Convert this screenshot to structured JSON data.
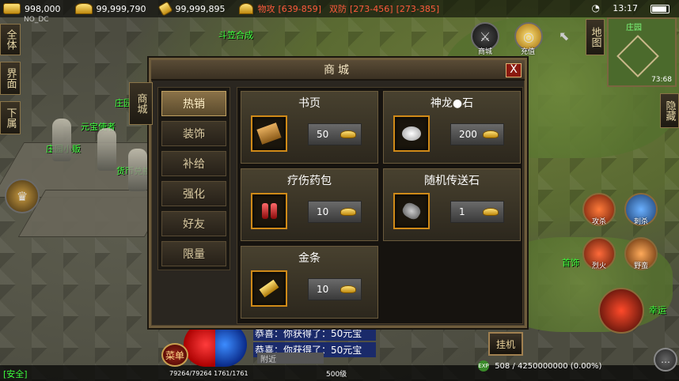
{
  "topbar": {
    "gold": "998,000",
    "ingot": "99,999,790",
    "bound_ingot": "99,999,895",
    "attack_label": "物攻",
    "attack_value": "[639-859]",
    "defense_label": "双防",
    "defense_value": "[273-456]",
    "defense_value2": "[273-385]",
    "clock": "13:17",
    "top_overlay": "NO_DC"
  },
  "left_side": [
    "全体",
    "界面",
    "下属"
  ],
  "right_side": {
    "map": "地图",
    "hide": "隐藏"
  },
  "minimap": {
    "name": "庄园",
    "coords": "73:68"
  },
  "top_icons": {
    "shop": "商城",
    "recharge": "充值"
  },
  "npcs": {
    "hat_merge": "斗笠合成",
    "yuanbao_envoy": "元宝使者",
    "manor_vendor": "庄园小贩",
    "currency_exchange": "货币兑换",
    "manor_master": "庄园"
  },
  "skills": {
    "s1": "攻杀",
    "s2": "刺杀",
    "s3": "烈火",
    "s4": "野蛮",
    "jewelry": "首饰",
    "luck": "幸运"
  },
  "shop": {
    "title": "商城",
    "close": "X",
    "side_tab": "商城",
    "categories": [
      "热销",
      "装饰",
      "补给",
      "强化",
      "好友",
      "限量"
    ],
    "items": [
      {
        "name": "书页",
        "price": "50"
      },
      {
        "name": "神龙●石",
        "price": "200"
      },
      {
        "name": "疗伤药包",
        "price": "10"
      },
      {
        "name": "随机传送石",
        "price": "1"
      },
      {
        "name": "金条",
        "price": "10"
      }
    ]
  },
  "bottom": {
    "safe": "[安全]",
    "menu": "菜单",
    "hp": "79264/79264",
    "mp": "1761/1761",
    "chat": [
      "恭喜：你获得了：50元宝",
      "恭喜：你获得了：50元宝"
    ],
    "chat_tab": "附近",
    "level": "500级",
    "exp": "508 / 4250000000 (0.00%)",
    "exp_icon": "EXP",
    "hangup": "挂机",
    "chat_bubble": "…"
  },
  "colors": {
    "npc_name": "#3cff3c",
    "stat_label": "#ff5a3c",
    "chat_bg": "#1a2a6a",
    "item_border": "#d08a18"
  }
}
